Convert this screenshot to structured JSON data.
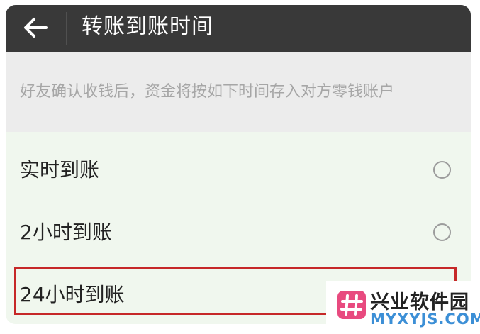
{
  "header": {
    "title": "转账到账时间",
    "back_icon": "arrow-left-icon"
  },
  "notice": {
    "text": "好友确认收钱后，资金将按如下时间存入对方零钱账户"
  },
  "options": [
    {
      "label": "实时到账",
      "selected": false
    },
    {
      "label": "2小时到账",
      "selected": false
    },
    {
      "label": "24小时到账",
      "selected": true
    }
  ],
  "watermark": {
    "name": "兴业软件园",
    "domain": "MYXYJS.COM"
  },
  "colors": {
    "topbar": "#393939",
    "notice_bg": "#ececec",
    "options_bg": "#f0f7ee",
    "highlight": "#c62828",
    "accent_green": "#1aad19",
    "watermark_blue": "#3c8fd6",
    "logo_pink": "#e84a7f"
  }
}
